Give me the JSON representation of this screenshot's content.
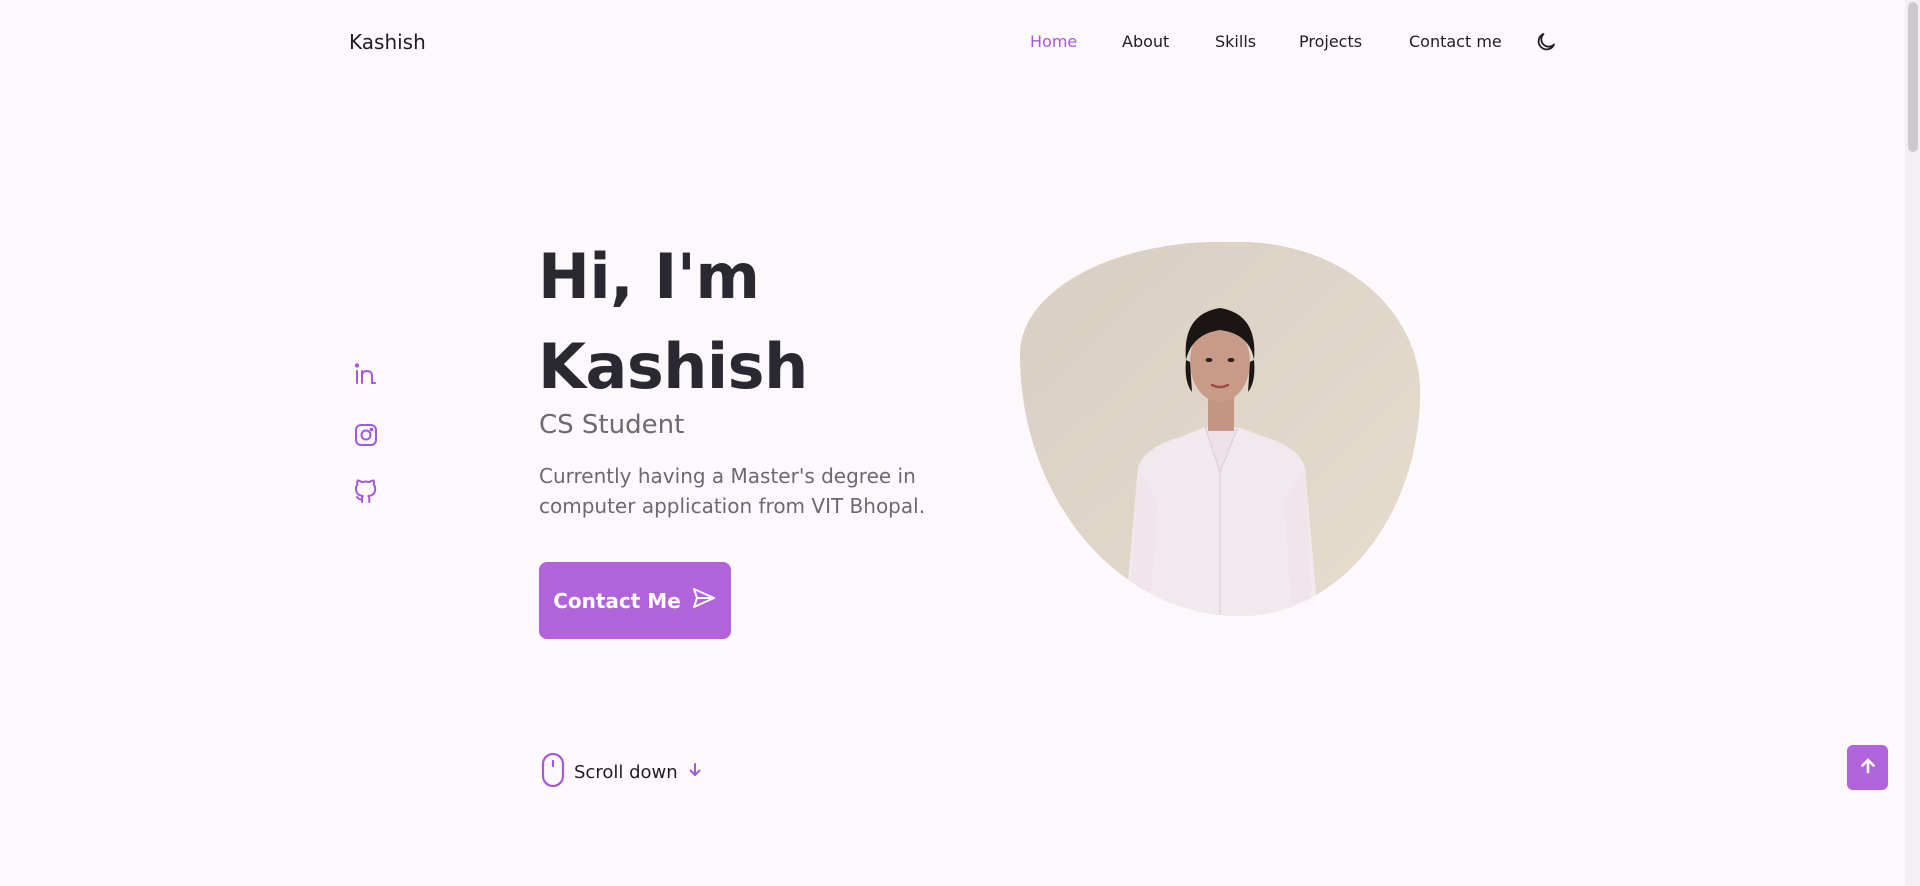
{
  "header": {
    "logo": "Kashish",
    "nav": [
      {
        "label": "Home",
        "active": true
      },
      {
        "label": "About",
        "active": false
      },
      {
        "label": "Skills",
        "active": false
      },
      {
        "label": "Projects",
        "active": false
      },
      {
        "label": "Contact me",
        "active": false
      }
    ],
    "theme_icon": "moon-icon"
  },
  "social": [
    "linkedin-icon",
    "instagram-icon",
    "github-icon"
  ],
  "hero": {
    "title_line1": "Hi, I'm",
    "title_line2": "Kashish",
    "subtitle": "CS Student",
    "description": "Currently having a Master's degree in computer application from VIT Bhopal.",
    "button_label": "Contact Me",
    "button_icon": "send-icon"
  },
  "scroll": {
    "label": "Scroll down",
    "icon": "mouse-icon",
    "arrow_icon": "arrow-down-icon"
  },
  "scrollup_icon": "arrow-up-icon",
  "colors": {
    "accent": "#b163d9",
    "background": "#fcf8fc",
    "text": "#1f1d24",
    "muted": "#6d6873"
  }
}
